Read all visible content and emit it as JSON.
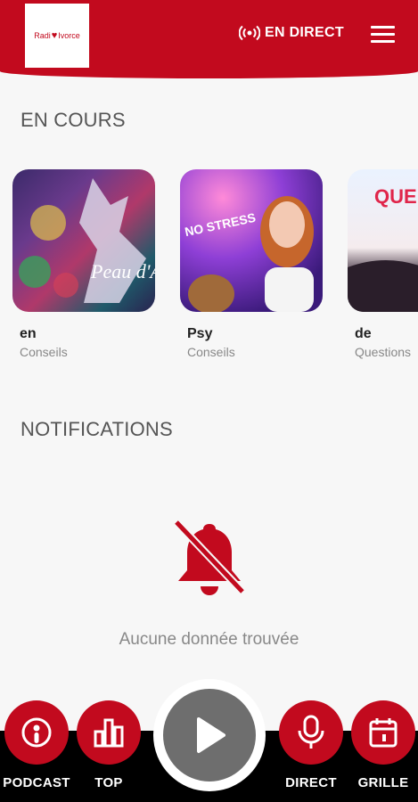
{
  "header": {
    "logo_text_left": "Radi",
    "logo_text_right": "Ivorce",
    "live_label": "EN DIRECT"
  },
  "current_section": {
    "title": "EN COURS",
    "cards": [
      {
        "title": "en",
        "category": "Conseils",
        "thumb_text": "Peau d'Ane"
      },
      {
        "title": "Psy",
        "category": "Conseils",
        "thumb_text": "NO STRESS"
      },
      {
        "title": "de",
        "category": "Questions",
        "thumb_text": "QUE T"
      }
    ]
  },
  "notifications": {
    "title": "NOTIFICATIONS",
    "empty_text": "Aucune donnée trouvée"
  },
  "bottom_nav": {
    "podcast": "PODCAST",
    "top": "TOP",
    "direct": "DIRECT",
    "grille": "GRILLE"
  },
  "colors": {
    "brand_red": "#c20a1e",
    "play_gray": "#6e6e6e"
  },
  "icons": [
    "broadcast-icon",
    "menu-icon",
    "bell-off-icon",
    "podcast-icon",
    "bar-chart-icon",
    "play-icon",
    "microphone-icon",
    "calendar-icon"
  ]
}
